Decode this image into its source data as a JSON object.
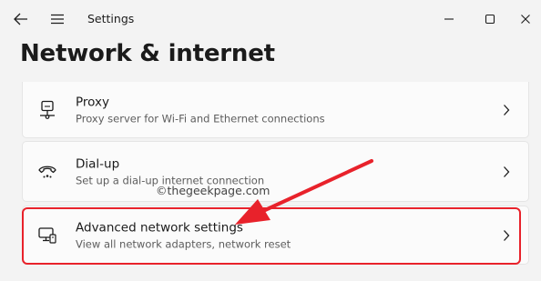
{
  "window": {
    "app_title": "Settings"
  },
  "page": {
    "title": "Network & internet"
  },
  "items": [
    {
      "title": "Proxy",
      "description": "Proxy server for Wi-Fi and Ethernet connections",
      "icon": "proxy-monitor-icon"
    },
    {
      "title": "Dial-up",
      "description": "Set up a dial-up internet connection",
      "icon": "dialup-phone-icon"
    },
    {
      "title": "Advanced network settings",
      "description": "View all network adapters, network reset",
      "icon": "network-adapters-icon"
    }
  ],
  "annotation": {
    "watermark": "©thegeekpage.com",
    "highlight_color": "#e8222b",
    "arrow_color": "#e8222b"
  },
  "colors": {
    "background": "#f3f3f3",
    "card_background": "#fbfbfb",
    "text_primary": "#1b1b1b",
    "text_secondary": "#5d5d5d"
  }
}
